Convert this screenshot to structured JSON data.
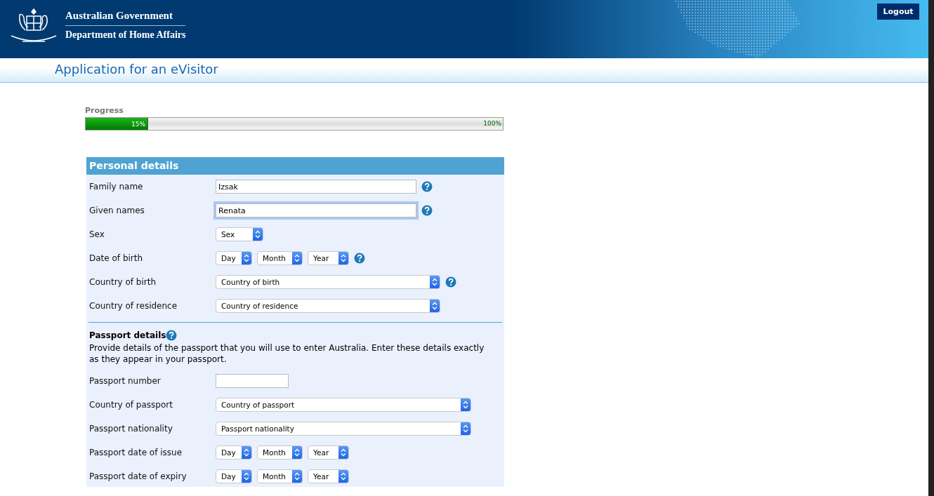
{
  "header": {
    "government": "Australian Government",
    "department": "Department of Home Affairs",
    "logout": "Logout"
  },
  "page_title": "Application for an eVisitor",
  "progress": {
    "label": "Progress",
    "level": 0.15,
    "reading": "15%",
    "end_reading": "100%"
  },
  "personal": {
    "title": "Personal details",
    "rows": [
      {
        "label": "Family name",
        "kind": "text",
        "value": "Izsak",
        "focused": false,
        "help": true
      },
      {
        "label": "Given names",
        "kind": "text",
        "value": "Renata",
        "focused": true,
        "help": true
      },
      {
        "label": "Sex",
        "kind": "small-select",
        "options": [
          "Sex"
        ],
        "help": false
      },
      {
        "label": "Date of birth",
        "kind": "date",
        "options": [
          "Day",
          "Month",
          "Year"
        ],
        "help": true
      },
      {
        "label": "Country of birth",
        "kind": "wide-select",
        "options": [
          "Country of birth"
        ],
        "help": true
      },
      {
        "label": "Country of residence",
        "kind": "wide-select",
        "options": [
          "Country of residence"
        ],
        "help": false
      }
    ]
  },
  "passport": {
    "title": "Passport details",
    "help": true,
    "intro": "Provide details of the passport that you will use to enter Australia. Enter these details exactly as they appear in your passport.",
    "rows": [
      {
        "label": "Passport number",
        "kind": "short-text",
        "value": "",
        "focused": false,
        "help": false
      },
      {
        "label": "Country of passport",
        "kind": "wider-select",
        "options": [
          "Country of passport"
        ],
        "help": false
      },
      {
        "label": "Passport nationality",
        "kind": "wider-select",
        "options": [
          "Passport nationality"
        ],
        "help": false
      },
      {
        "label": "Passport date of issue",
        "kind": "date",
        "options": [
          "Day",
          "Month",
          "Year"
        ],
        "help": false
      },
      {
        "label": "Passport date of expiry",
        "kind": "date",
        "options": [
          "Day",
          "Month",
          "Year"
        ],
        "help": false
      }
    ]
  }
}
